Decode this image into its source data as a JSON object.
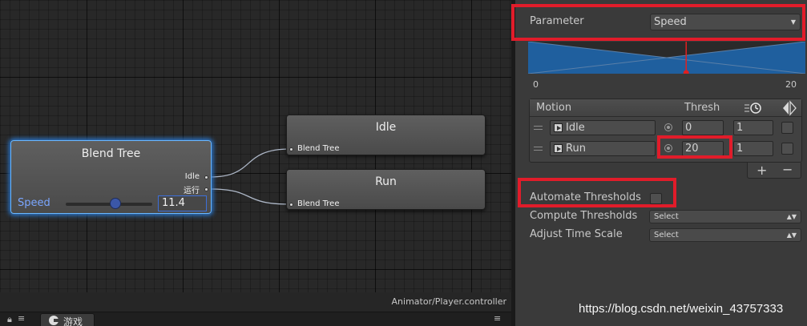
{
  "graph": {
    "blend_tree": {
      "title": "Blend Tree",
      "outputs": [
        "Idle",
        "运行"
      ],
      "param_label": "Speed",
      "param_value": "11.4",
      "slider_fraction": 0.57
    },
    "nodes": [
      {
        "title": "Idle",
        "input_label": "Blend Tree"
      },
      {
        "title": "Run",
        "input_label": "Blend Tree"
      }
    ],
    "controller_path": "Animator/Player.controller"
  },
  "tabs": {
    "game_tab_label": "游戏",
    "lock_icon": "lock-icon",
    "menu_icon": "menu-icon"
  },
  "inspector": {
    "parameter_label": "Parameter",
    "parameter_value": "Speed",
    "range_min": "0",
    "range_max": "20",
    "preview_marker_fraction": 0.57,
    "motion_header": {
      "motion": "Motion",
      "thresh": "Thresh"
    },
    "motions": [
      {
        "clip": "Idle",
        "threshold": "0",
        "speed": "1"
      },
      {
        "clip": "Run",
        "threshold": "20",
        "speed": "1"
      }
    ],
    "add_label": "+",
    "remove_label": "−",
    "automate_thresholds_label": "Automate Thresholds",
    "automate_thresholds_checked": false,
    "compute_thresholds_label": "Compute Thresholds",
    "compute_thresholds_value": "Select",
    "adjust_time_scale_label": "Adjust Time Scale",
    "adjust_time_scale_value": "Select"
  },
  "watermark": "https://blog.csdn.net/weixin_43757333",
  "colors": {
    "highlight": "#e11c2a",
    "selection_glow": "#2b78d0",
    "param_blue": "#7aa6ff",
    "preview_fill": "#1f5f9e"
  }
}
